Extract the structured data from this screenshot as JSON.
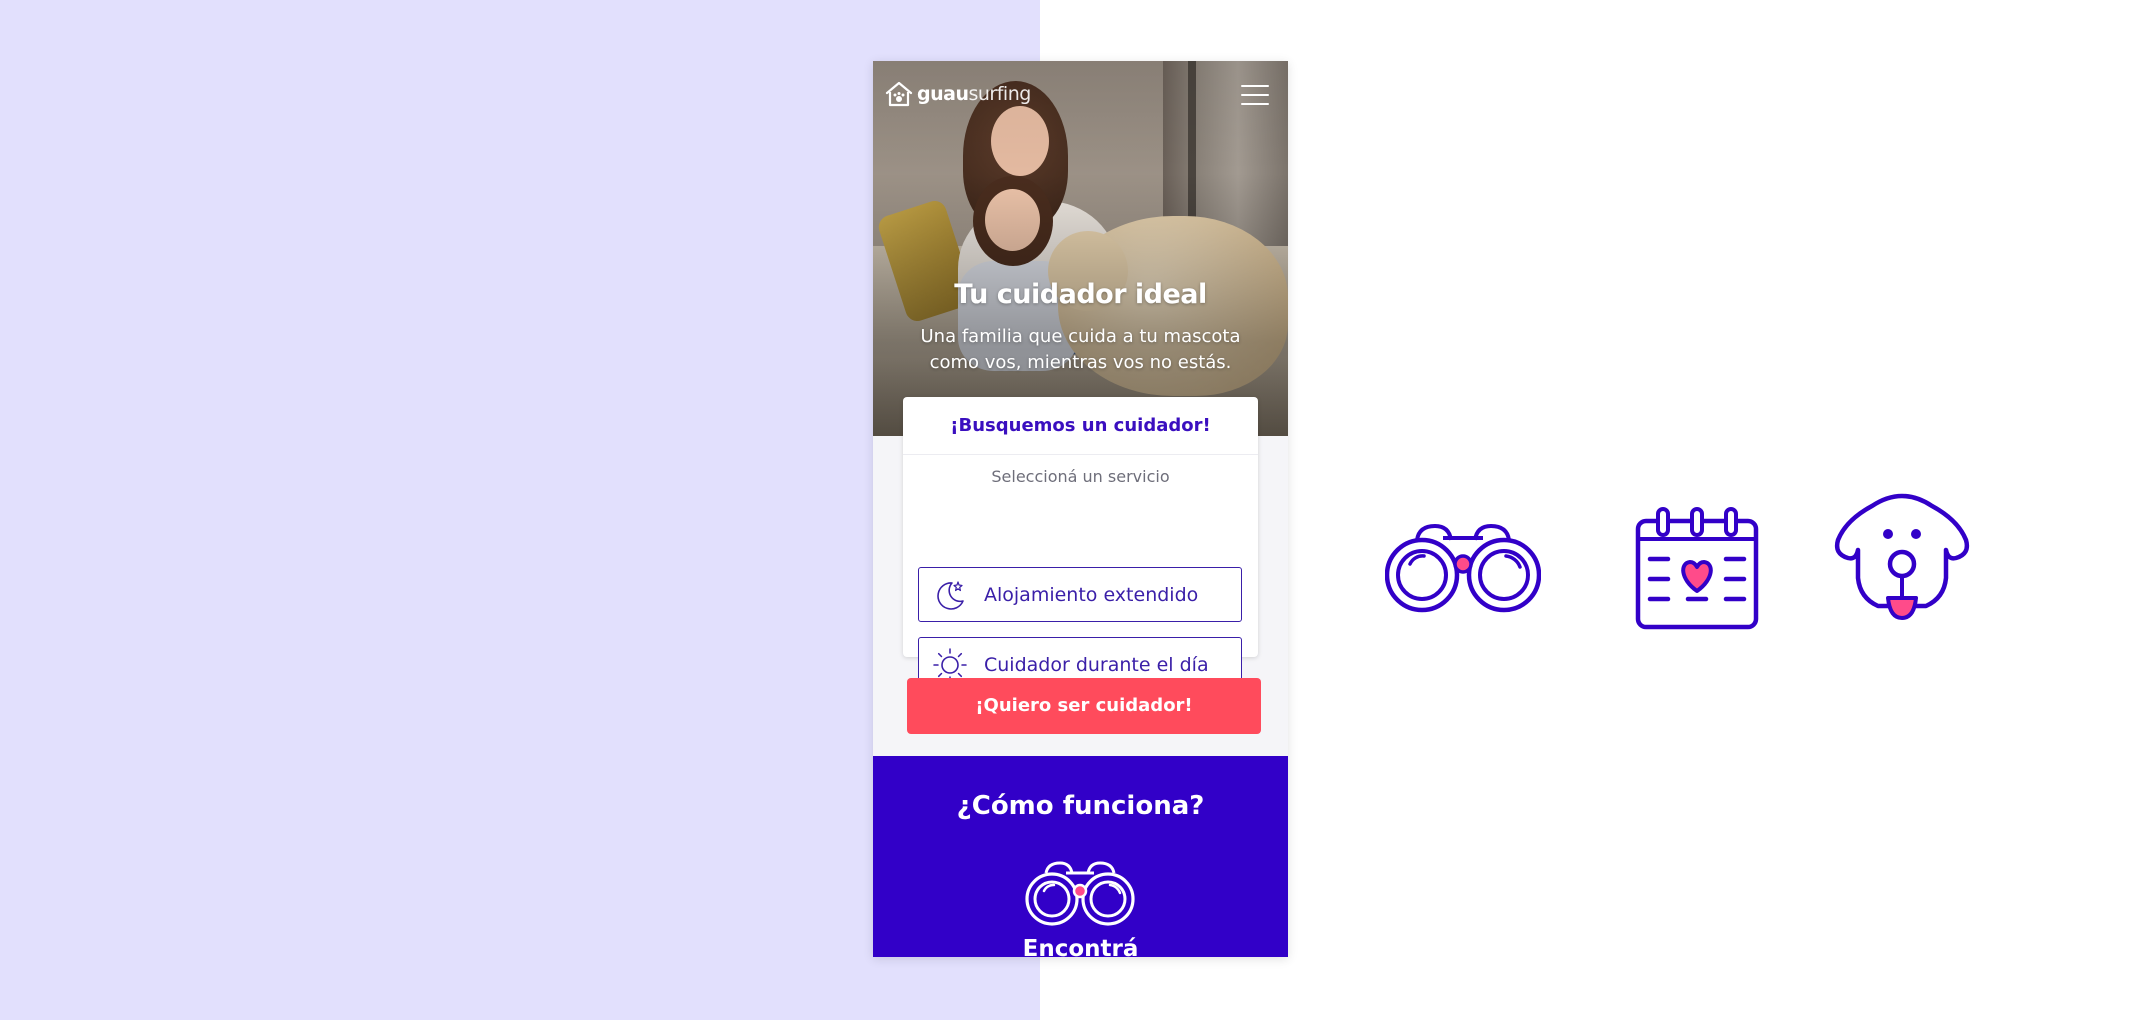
{
  "brand": {
    "logo_bold": "guau",
    "logo_light": "surfing"
  },
  "hero": {
    "title": "Tu cuidador ideal",
    "subtitle": "Una familia que cuida a tu mascota como vos, mientras vos no estás."
  },
  "search": {
    "title": "¡Busquemos un cuidador!",
    "label": "Seleccioná un servicio",
    "services": [
      {
        "label": "Alojamiento extendido",
        "icon": "moon-star-icon"
      },
      {
        "label": "Cuidador durante el día",
        "icon": "sun-icon"
      }
    ]
  },
  "cta": {
    "label": "¡Quiero ser cuidador!"
  },
  "how": {
    "title": "¿Cómo funciona?",
    "step_1": "Encontrá"
  },
  "colors": {
    "primary": "#3200c8",
    "accent": "#ff4b5c",
    "pink": "#ff4b8a",
    "backdrop": "#e2e0fd"
  }
}
